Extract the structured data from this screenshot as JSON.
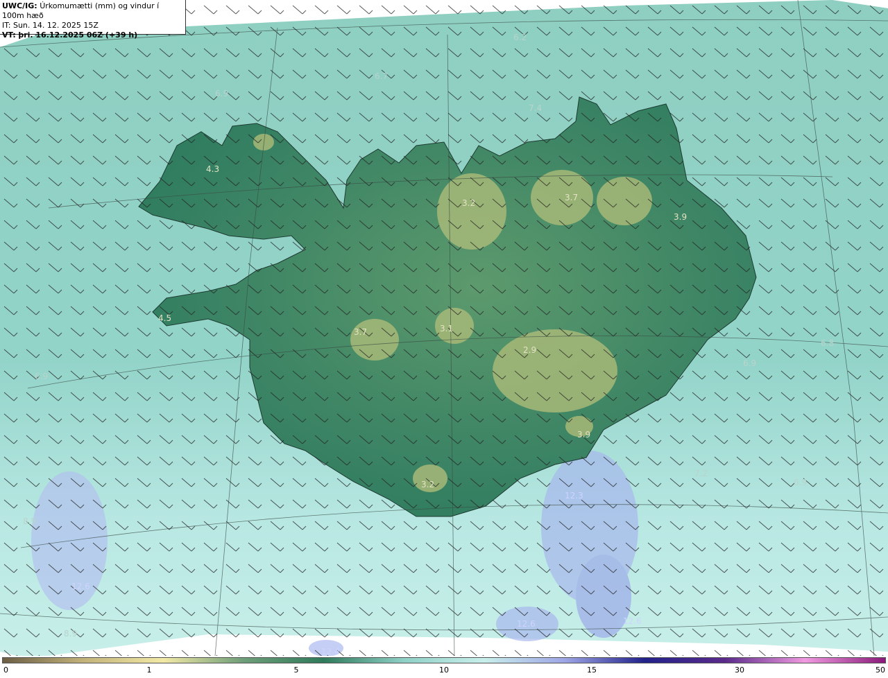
{
  "header": {
    "line1_bold": "UWC/IG:",
    "line1_text": "Úrkomumætti (mm) og vindur í 100m hæð",
    "line2": "IT: Sun. 14. 12. 2025 15Z",
    "line3_bold": "VT:",
    "line3_text": "þri. 16.12.2025 06Z (+39 h)"
  },
  "map_values": {
    "sea_n1": "6.2",
    "sea_n2": "7.4",
    "sea_n3": "6.7",
    "sea_nw": "6.9",
    "wf": "4.3",
    "nc": "3.2",
    "ne": "3.7",
    "e": "3.9",
    "w": "4.5",
    "wc": "3.7",
    "c": "3.1",
    "se": "2.9",
    "s": "3.2",
    "s2": "3.9",
    "sea_e1": "6.8",
    "sea_e2": "6.9",
    "sea_se1": "7.2",
    "sea_se2": "6.9",
    "sea_s1": "12.3",
    "sea_s2": "12.6",
    "sea_s3": "12.6",
    "sea_s4": "12.4",
    "sea_sw1": "12.6",
    "sea_sw2": "8.9",
    "sea_sw3": "8.9",
    "sea_w": "6.9"
  },
  "colorbar": {
    "ticks": [
      "0",
      "1",
      "5",
      "10",
      "15",
      "30",
      "50"
    ],
    "colors": [
      "#6b5e45",
      "#c2b27a",
      "#f2e9a6",
      "#6f9e79",
      "#2f7a5b",
      "#8fd0c6",
      "#c8eeea",
      "#9fa6e6",
      "#22228a",
      "#5a2a8a",
      "#f09ae0",
      "#8a1a7a"
    ]
  }
}
